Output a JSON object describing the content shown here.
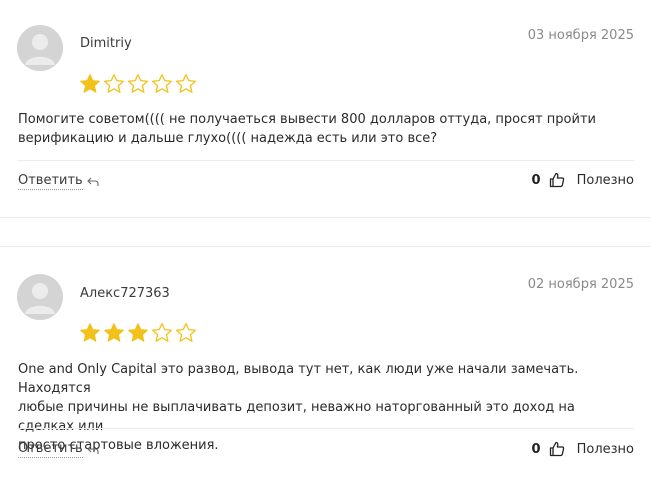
{
  "colors": {
    "star_filled": "#F2C21B",
    "star_empty_stroke": "#F2C21B",
    "avatar_bg": "#D4D4D4"
  },
  "reviews": [
    {
      "author": "Dimitriy",
      "date": "03 ноября 2025",
      "rating": 1,
      "max_rating": 5,
      "text_lines": [
        "Помогите советом(((( не получаеться вывести 800 долларов оттуда, просят пройти",
        "верификацию и дальше глухо(((( надежда есть или это все?"
      ],
      "reply_label": "Ответить",
      "vote_count": "0",
      "useful_label": "Полезно"
    },
    {
      "author": "Алекс727363",
      "date": "02 ноября 2025",
      "rating": 3,
      "max_rating": 5,
      "text_lines": [
        "One and Only Capital это развод, вывода тут нет, как люди уже начали замечать. Находятся",
        "любые причины не выплачивать депозит, неважно наторгованный это доход на сделках или",
        "просто стартовые вложения."
      ],
      "reply_label": "Ответить",
      "vote_count": "0",
      "useful_label": "Полезно"
    }
  ]
}
